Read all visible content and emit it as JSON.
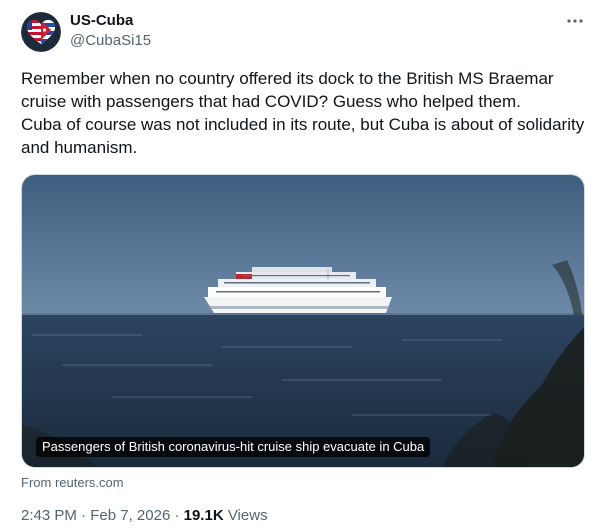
{
  "author": {
    "name": "US-Cuba",
    "handle": "@CubaSi15"
  },
  "tweet": {
    "lines": [
      "Remember when no country offered its dock to the British MS Braemar",
      "cruise with passengers that had COVID? Guess who helped them.",
      "Cuba of course was not included in its route, but Cuba is about of solidarity",
      "and humanism."
    ]
  },
  "card": {
    "caption": "Passengers of British coronavirus-hit cruise ship evacuate in Cuba",
    "source": "From reuters.com"
  },
  "meta": {
    "time": "2:43 PM",
    "separator": "·",
    "date": "Feb 7, 2026",
    "views_count": "19.1K",
    "views_label": "Views"
  },
  "icons": {
    "avatar": "us-cuba-flag-heart-avatar",
    "more": "more-options-icon"
  },
  "colors": {
    "text": "#0f1419",
    "secondary": "#536471",
    "border": "#cfd9de"
  }
}
